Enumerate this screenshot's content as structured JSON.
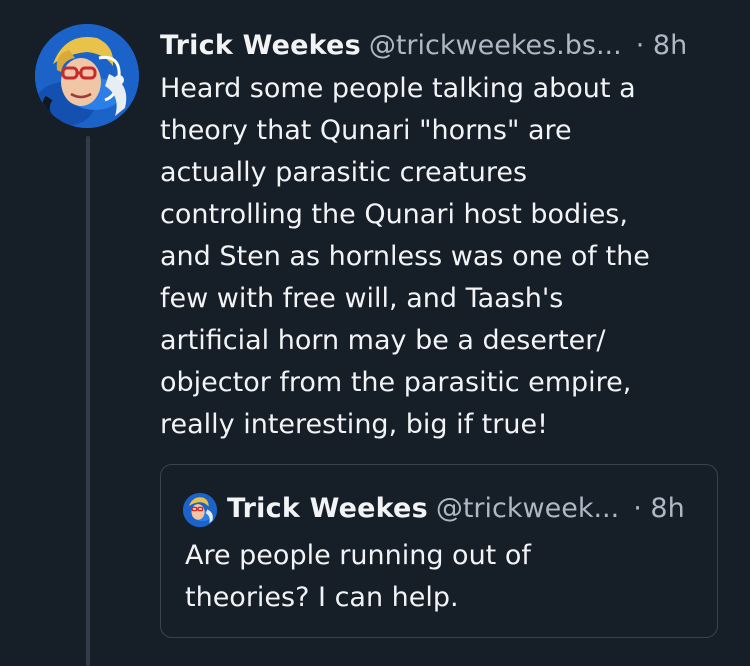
{
  "post": {
    "display_name": "Trick Weekes",
    "handle": "@trickweekes.bs...",
    "separator": "·",
    "time": "8h",
    "text": "Heard some people talking about a\ntheory that Qunari \"horns\" are\nactually parasitic creatures\ncontrolling the Qunari host bodies,\nand Sten as hornless was one of the\nfew with free will, and Taash's\nartificial horn may be a deserter/\nobjector from the parasitic empire,\nreally interesting, big if true!"
  },
  "quote": {
    "display_name": "Trick Weekes",
    "handle": "@trickweek...",
    "separator": "·",
    "time": "8h",
    "text": "Are people running out of\ntheories? I can help."
  },
  "colors": {
    "background": "#161e27",
    "text": "#f1f3f5",
    "secondary_text": "#aeb8c4",
    "border": "#39434f",
    "avatar_blue": "#1b63c9"
  }
}
